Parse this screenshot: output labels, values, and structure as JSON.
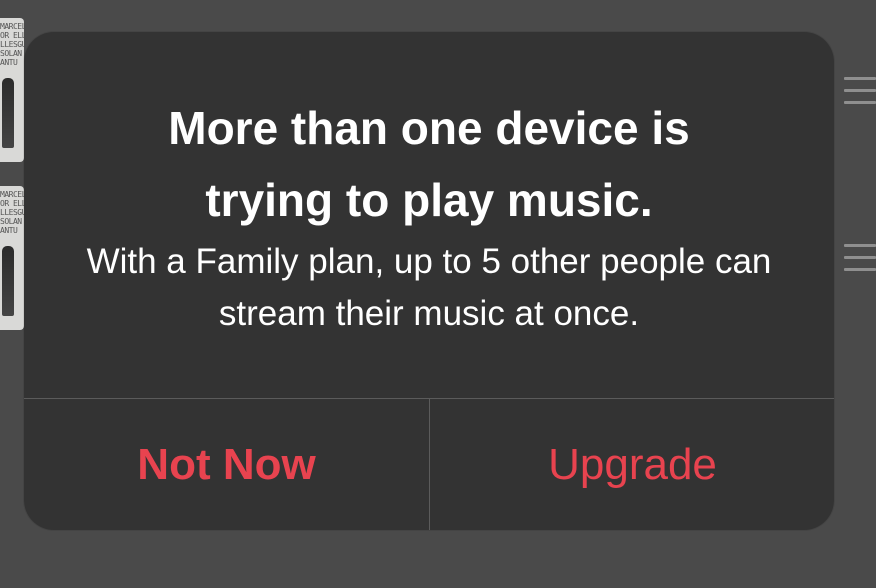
{
  "background": {
    "album_text": "MARCEL\nOR ELL\nLLESGU\nSOLAN\nANTU"
  },
  "alert": {
    "title": "More than one device is trying to play music.",
    "message": "With a Family plan, up to 5 other people can stream their music at once.",
    "buttons": {
      "not_now": "Not Now",
      "upgrade": "Upgrade"
    }
  },
  "colors": {
    "accent": "#e8434f",
    "alert_background": "#333333",
    "screen_background": "#4a4a4a"
  }
}
